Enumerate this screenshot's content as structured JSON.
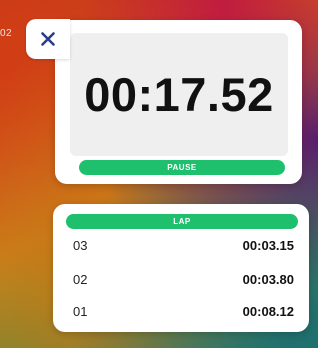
{
  "wallpaper": {
    "edge_text": "02"
  },
  "close_button": {
    "icon": "close-icon",
    "color": "#2b3e8c"
  },
  "timer": {
    "value": "00:17.52"
  },
  "pause_button": {
    "label": "PAUSE",
    "color": "#1ec06e"
  },
  "lap_button": {
    "label": "LAP",
    "color": "#1ec06e"
  },
  "laps": [
    {
      "number": "03",
      "time": "00:03.15"
    },
    {
      "number": "02",
      "time": "00:03.80"
    },
    {
      "number": "01",
      "time": "00:08.12"
    }
  ]
}
